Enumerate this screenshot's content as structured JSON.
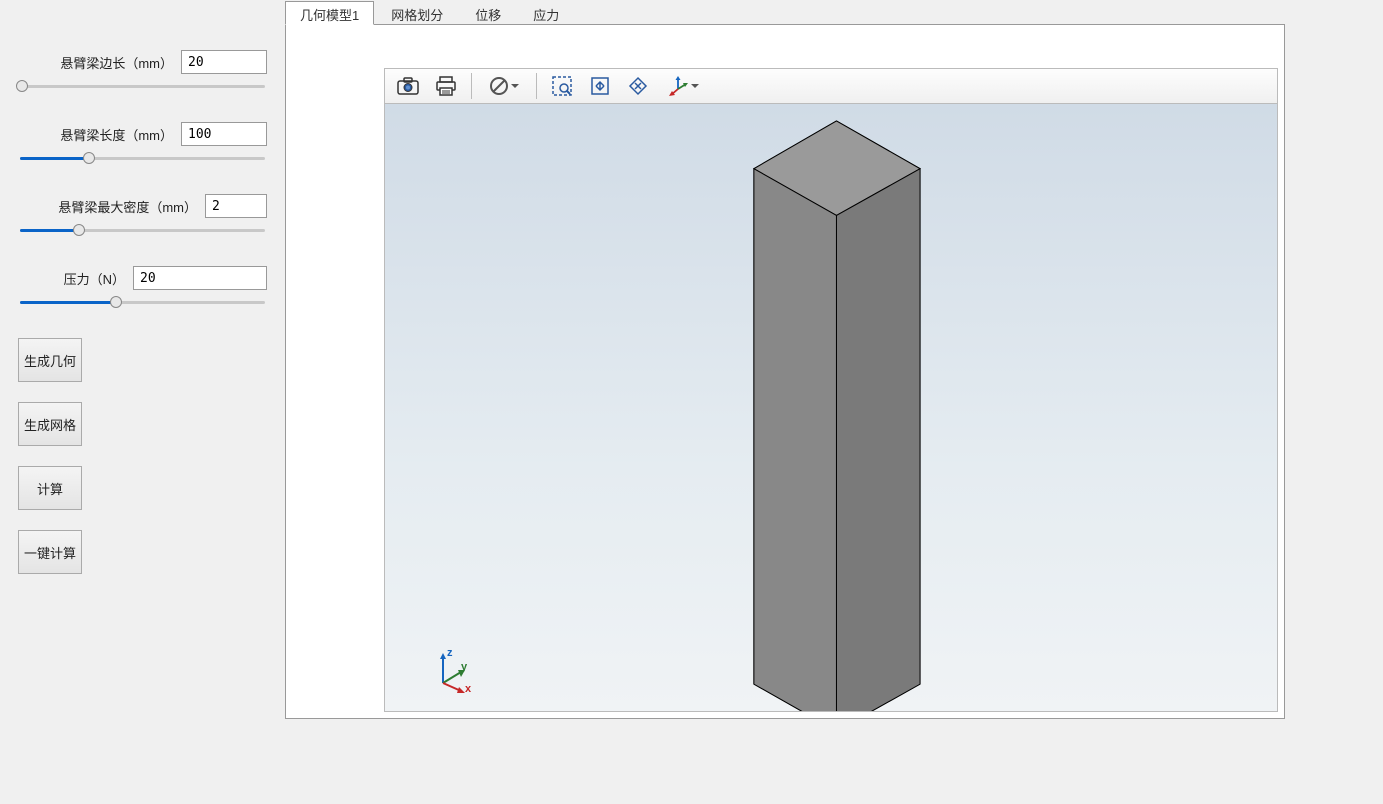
{
  "params": {
    "side_length": {
      "label": "悬臂梁边长（mm）",
      "value": "20",
      "slider_pct": 1
    },
    "length": {
      "label": "悬臂梁长度（mm）",
      "value": "100",
      "slider_pct": 28
    },
    "density": {
      "label": "悬臂梁最大密度（mm）",
      "value": "2",
      "slider_pct": 24
    },
    "pressure": {
      "label": "压力（N）",
      "value": "20",
      "slider_pct": 39
    }
  },
  "buttons": {
    "gen_geometry": "生成几何",
    "gen_mesh": "生成网格",
    "calculate": "计算",
    "one_click": "一键计算"
  },
  "tabs": {
    "geometry": "几何模型1",
    "mesh": "网格划分",
    "displacement": "位移",
    "stress": "应力"
  },
  "axes": {
    "x": "x",
    "y": "y",
    "z": "z"
  }
}
